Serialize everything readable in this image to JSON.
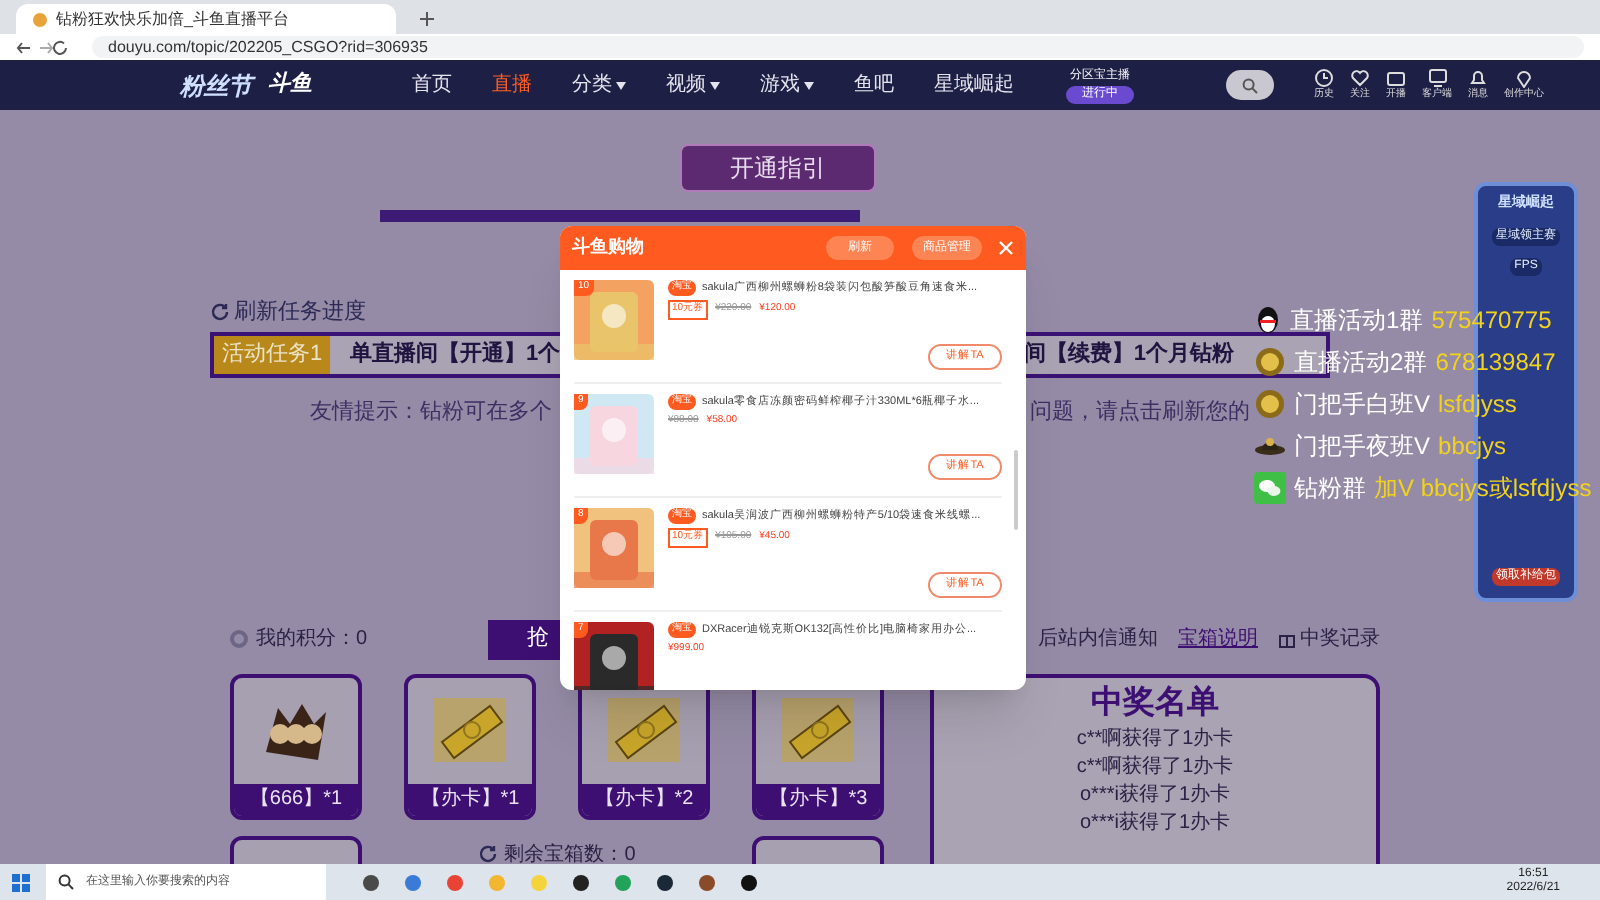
{
  "browser": {
    "tab_title": "钻粉狂欢快乐加倍_斗鱼直播平台",
    "url": "douyu.com/topic/202205_CSGO?rid=306935"
  },
  "site_nav": {
    "logo": "粉丝节",
    "brand": "斗鱼",
    "items": [
      {
        "label": "首页",
        "selected": false,
        "dropdown": false
      },
      {
        "label": "直播",
        "selected": true,
        "dropdown": false
      },
      {
        "label": "分类",
        "selected": false,
        "dropdown": true
      },
      {
        "label": "视频",
        "selected": false,
        "dropdown": true
      },
      {
        "label": "游戏",
        "selected": false,
        "dropdown": true
      },
      {
        "label": "鱼吧",
        "selected": false,
        "dropdown": false
      },
      {
        "label": "星域崛起",
        "selected": false,
        "dropdown": false
      }
    ],
    "promo": {
      "title": "分区宝主播",
      "badge": "进行中"
    },
    "actions": [
      {
        "label": "历史",
        "kind": "clock"
      },
      {
        "label": "关注",
        "kind": "heart"
      },
      {
        "label": "开播",
        "kind": "camera"
      },
      {
        "label": "客户端",
        "kind": "download"
      },
      {
        "label": "消息",
        "kind": "bell"
      },
      {
        "label": "创作中心",
        "kind": "pin"
      }
    ]
  },
  "page": {
    "guide_button": "开通指引",
    "refresh_label": "刷新任务进度",
    "task": {
      "tag": "活动任务1",
      "text_left": "单直播间【开通】1个",
      "text_right": "间【续费】1个月钻粉"
    },
    "tip_left": "友情提示：钻粉可在多个",
    "tip_right": "问题，请点击刷新您的"
  },
  "groups": [
    {
      "kind": "qq",
      "label": "直播活动1群",
      "value": "575470775"
    },
    {
      "kind": "coin",
      "label": "直播活动2群",
      "value": "678139847"
    },
    {
      "kind": "coin",
      "label": "门把手白班V",
      "value": "lsfdjyss"
    },
    {
      "kind": "hat",
      "label": "门把手夜班V",
      "value": "bbcjys"
    },
    {
      "kind": "wechat",
      "label": "钻粉群",
      "value": "加V bbcjys或lsfdjyss"
    }
  ],
  "points": {
    "label": "我的积分：0",
    "grab_button": "抢"
  },
  "links": [
    {
      "kind": "text",
      "label": "后站内信通知"
    },
    {
      "kind": "link",
      "label": "宝箱说明"
    },
    {
      "kind": "gift",
      "label": "中奖记录"
    }
  ],
  "prizes": [
    {
      "kind": "emblem",
      "label": "【666】*1"
    },
    {
      "kind": "card",
      "label": "【办卡】*1"
    },
    {
      "kind": "card",
      "label": "【办卡】*2"
    },
    {
      "kind": "card",
      "label": "【办卡】*3"
    }
  ],
  "remaining": "剩余宝箱数：0",
  "winners": {
    "title": "中奖名单",
    "rows": [
      "c**啊获得了1办卡",
      "c**啊获得了1办卡",
      "o***i获得了1办卡",
      "o***i获得了1办卡"
    ]
  },
  "shop_modal": {
    "title": "斗鱼购物",
    "refresh": "刷新",
    "manage": "商品管理",
    "products": [
      {
        "rank": "10",
        "tag": "淘宝",
        "title": "sakula广西柳州螺蛳粉8袋装闪包酸笋酸豆角速食米...",
        "coupon": "10元券",
        "original_price": "¥220.00",
        "price": "¥120.00",
        "button": "讲解TA"
      },
      {
        "rank": "9",
        "tag": "淘宝",
        "title": "sakula零食店冻颜密码鲜榨椰子汁330ML*6瓶椰子水...",
        "original_price": "¥88.00",
        "price": "¥58.00",
        "button": "讲解TA"
      },
      {
        "rank": "8",
        "tag": "淘宝",
        "title": "sakula吴润波广西柳州螺蛳粉特产5/10袋速食米线螺...",
        "coupon": "10元券",
        "original_price": "¥105.00",
        "price": "¥45.00",
        "button": "讲解TA"
      },
      {
        "rank": "7",
        "tag": "淘宝",
        "title": "DXRacer迪锐克斯OK132[高性价比]电脑椅家用办公...",
        "price": "¥999.00"
      }
    ]
  },
  "side_banner": {
    "title": "星域崛起",
    "lines": [
      "星域领主赛",
      "FPS"
    ],
    "footer": "领取补给包"
  },
  "taskbar": {
    "search_placeholder": "在这里输入你要搜索的内容",
    "time": "16:51",
    "date": "2022/6/21"
  }
}
